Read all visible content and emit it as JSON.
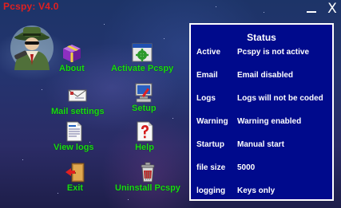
{
  "window": {
    "title": "Pcspy: V4.0",
    "minimize_icon": "minimize-icon",
    "close_label": "X"
  },
  "colors": {
    "title": "#e02020",
    "label_green": "#1bd818",
    "panel_bg": "#000a8c"
  },
  "logo": {
    "icon": "spy-detective-icon"
  },
  "shortcuts": [
    {
      "label": "About",
      "icon": "gift-box-icon"
    },
    {
      "label": "Activate Pcspy",
      "icon": "window-gear-icon"
    },
    {
      "label": "Mail settings",
      "icon": "mail-envelope-icon"
    },
    {
      "label": "Setup",
      "icon": "computer-setup-icon"
    },
    {
      "label": "View logs",
      "icon": "log-document-icon"
    },
    {
      "label": "Help",
      "icon": "help-question-icon"
    },
    {
      "label": "Exit",
      "icon": "exit-door-icon"
    },
    {
      "label": "Uninstall Pcspy",
      "icon": "trash-can-icon"
    }
  ],
  "status": {
    "title": "Status",
    "rows": [
      {
        "key": "Active",
        "value": "Pcspy is not active"
      },
      {
        "key": "Email",
        "value": "Email disabled"
      },
      {
        "key": "Logs",
        "value": "Logs will not be coded"
      },
      {
        "key": "Warning",
        "value": "Warning enabled"
      },
      {
        "key": "Startup",
        "value": "Manual start"
      },
      {
        "key": "file size",
        "value": "5000"
      },
      {
        "key": "logging",
        "value": "Keys only"
      }
    ]
  }
}
